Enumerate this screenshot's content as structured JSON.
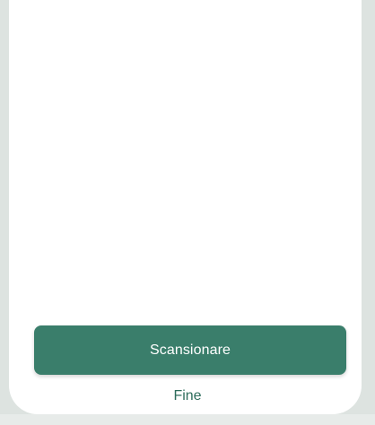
{
  "actions": {
    "scan_label": "Scansionare",
    "done_label": "Fine"
  },
  "colors": {
    "primary": "#3a7e6b",
    "link": "#2e6d5c",
    "background": "#dde3e0",
    "card": "#ffffff"
  }
}
